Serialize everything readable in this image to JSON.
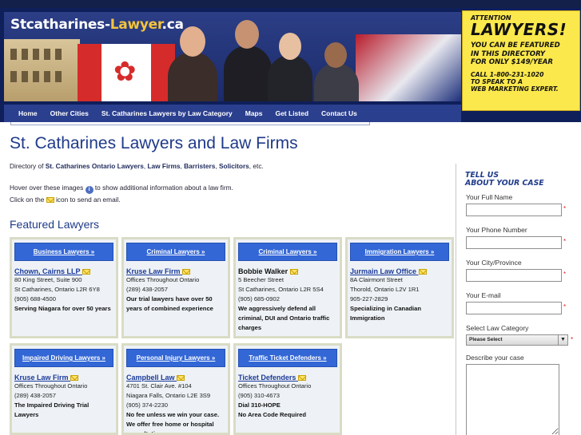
{
  "header": {
    "logo_main": "Stcatharines",
    "logo_sep": "-",
    "logo_brand": "Lawyer",
    "logo_suffix": ".ca"
  },
  "nav": {
    "items": [
      "Home",
      "Other Cities",
      "St. Catharines Lawyers by Law Category",
      "Maps",
      "Get Listed",
      "Contact Us"
    ]
  },
  "ad": {
    "attention": "ATTENTION",
    "headline": "LAWYERS!",
    "lines": [
      "YOU CAN BE FEATURED",
      "IN THIS DIRECTORY",
      "FOR ONLY $149/YEAR"
    ],
    "call_lines": [
      "CALL 1-800-231-1020",
      "TO SPEAK TO A",
      "WEB MARKETING EXPERT."
    ]
  },
  "page": {
    "title": "St. Catharines Lawyers and Law Firms",
    "intro_prefix": "Directory of ",
    "intro_b1": "St. Catharines Ontario Lawyers",
    "intro_sep1": ", ",
    "intro_b2": "Law Firms",
    "intro_sep2": ", ",
    "intro_b3": "Barristers",
    "intro_sep3": ", ",
    "intro_b4": "Solicitors",
    "intro_suffix": ", etc.",
    "hover_before": "Hover over these images ",
    "hover_after": " to show additional information about a law firm.",
    "click_before": "Click on the ",
    "click_after": " icon to send an email.",
    "featured_heading": "Featured Lawyers"
  },
  "featured": [
    {
      "category": "Business Lawyers »",
      "name": "Chown, Cairns LLP",
      "linked": true,
      "address": [
        "80 King Street, Suite 900",
        "St Catharines, Ontario L2R 6Y8",
        "(905) 688-4500"
      ],
      "description": "Serving Niagara for over 50 years"
    },
    {
      "category": "Criminal Lawyers »",
      "name": "Kruse Law Firm",
      "linked": true,
      "address": [
        "Offices Throughout Ontario",
        "(289) 438-2057"
      ],
      "description": "Our trial lawyers have over 50 years of combined experience"
    },
    {
      "category": "Criminal Lawyers »",
      "name": "Bobbie Walker",
      "linked": false,
      "address": [
        "5 Beecher Street",
        "St Catharines, Ontario L2R 5S4",
        "(905) 685-0902"
      ],
      "description": "We aggressively defend all criminal, DUI and Ontario traffic charges"
    },
    {
      "category": "Immigration Lawyers »",
      "name": "Jurmain Law Office",
      "linked": true,
      "address": [
        "8A Clairmont Street",
        "Thorold, Ontario L2V 1R1",
        "905-227-2829"
      ],
      "description": "Specializing in Canadian Immigration"
    },
    {
      "category": "Impaired Driving Lawyers »",
      "name": "Kruse Law Firm",
      "linked": true,
      "address": [
        "Offices Throughout Ontario",
        "(289) 438-2057"
      ],
      "description": "The Impaired Driving Trial Lawyers"
    },
    {
      "category": "Personal Injury Lawyers »",
      "name": "Campbell Law",
      "linked": true,
      "address": [
        "4701 St. Clair Ave. #104",
        "Niagara Falls, Ontario L2E 3S9",
        "(905) 374-2230"
      ],
      "description": "No fee unless we win your case.  We offer free home or hospital consultations"
    },
    {
      "category": "Traffic Ticket Defenders »",
      "name": "Ticket Defenders",
      "linked": true,
      "address": [
        "Offices Throughout Ontario",
        "(905) 310-4673"
      ],
      "description": "Dial 310-HOPE\nNo Area Code Required"
    }
  ],
  "form": {
    "heading_line1": "TELL US",
    "heading_line2": "ABOUT YOUR CASE",
    "full_name_label": "Your Full Name",
    "phone_label": "Your Phone Number",
    "city_label": "Your City/Province",
    "email_label": "Your E-mail",
    "category_label": "Select Law Category",
    "category_selected": "Please Select",
    "describe_label": "Describe your case",
    "required_mark": "*"
  },
  "colors": {
    "brand_navy": "#0f1f5a",
    "nav_blue": "#2b3f8f",
    "heading_blue": "#1f3a8a",
    "card_header_blue": "#3367d6",
    "ad_yellow": "#fbe84c"
  }
}
